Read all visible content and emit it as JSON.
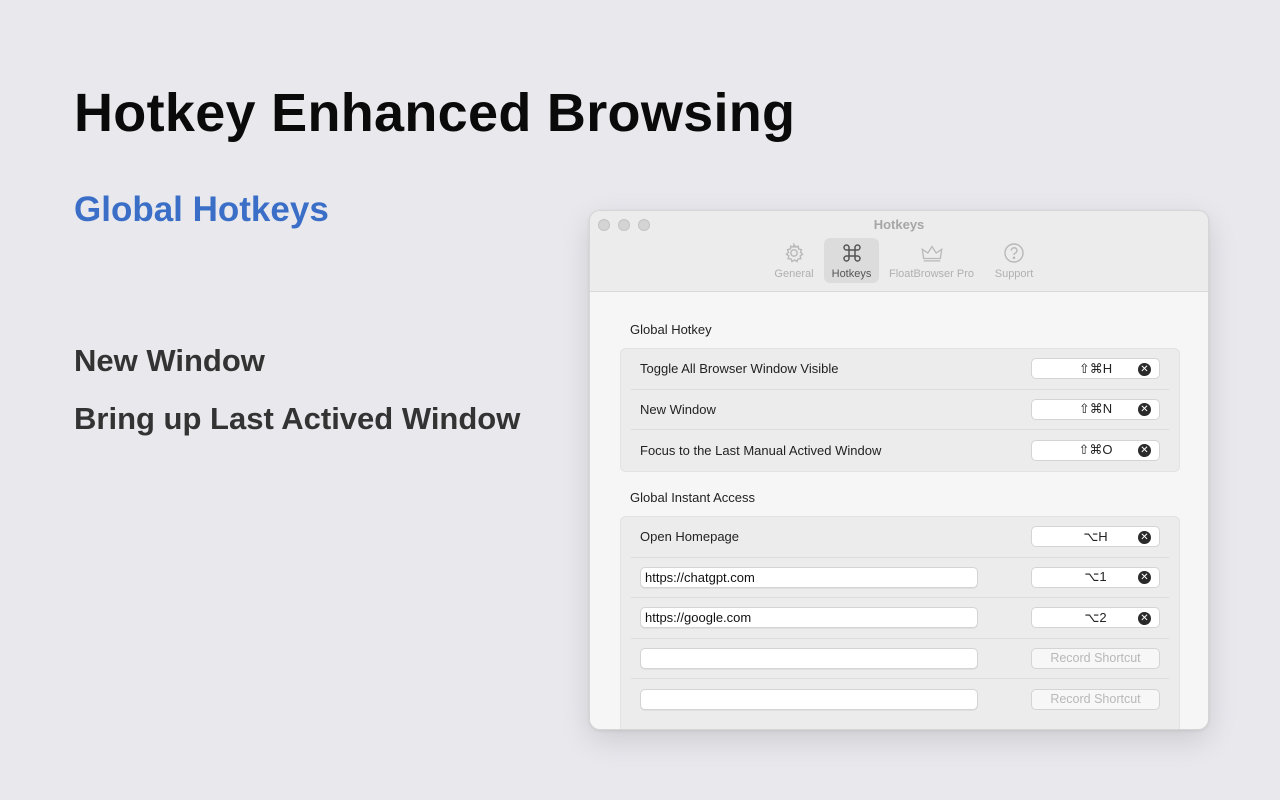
{
  "hero": {
    "title": "Hotkey Enhanced Browsing",
    "subtitle": "Global Hotkeys",
    "features": [
      "New Window",
      "Bring up Last Actived Window"
    ]
  },
  "window": {
    "title": "Hotkeys",
    "tabs": [
      {
        "label": "General",
        "icon": "gear-icon",
        "active": false
      },
      {
        "label": "Hotkeys",
        "icon": "command-icon",
        "active": true
      },
      {
        "label": "FloatBrowser Pro",
        "icon": "crown-icon",
        "active": false
      },
      {
        "label": "Support",
        "icon": "question-icon",
        "active": false
      }
    ]
  },
  "global_hotkey": {
    "title": "Global Hotkey",
    "rows": [
      {
        "label": "Toggle All Browser Window Visible",
        "shortcut": "⇧⌘H"
      },
      {
        "label": "New Window",
        "shortcut": "⇧⌘N"
      },
      {
        "label": "Focus to the Last Manual Actived Window",
        "shortcut": "⇧⌘O"
      }
    ]
  },
  "instant_access": {
    "title": "Global Instant Access",
    "homepage": {
      "label": "Open Homepage",
      "shortcut": "⌥H"
    },
    "urls": [
      {
        "value": "https://chatgpt.com",
        "shortcut": "⌥1"
      },
      {
        "value": "https://google.com",
        "shortcut": "⌥2"
      },
      {
        "value": "",
        "record": "Record Shortcut"
      },
      {
        "value": "",
        "record": "Record Shortcut"
      }
    ]
  },
  "colors": {
    "accent": "#3b6fc7",
    "background": "#e8e8ed"
  }
}
